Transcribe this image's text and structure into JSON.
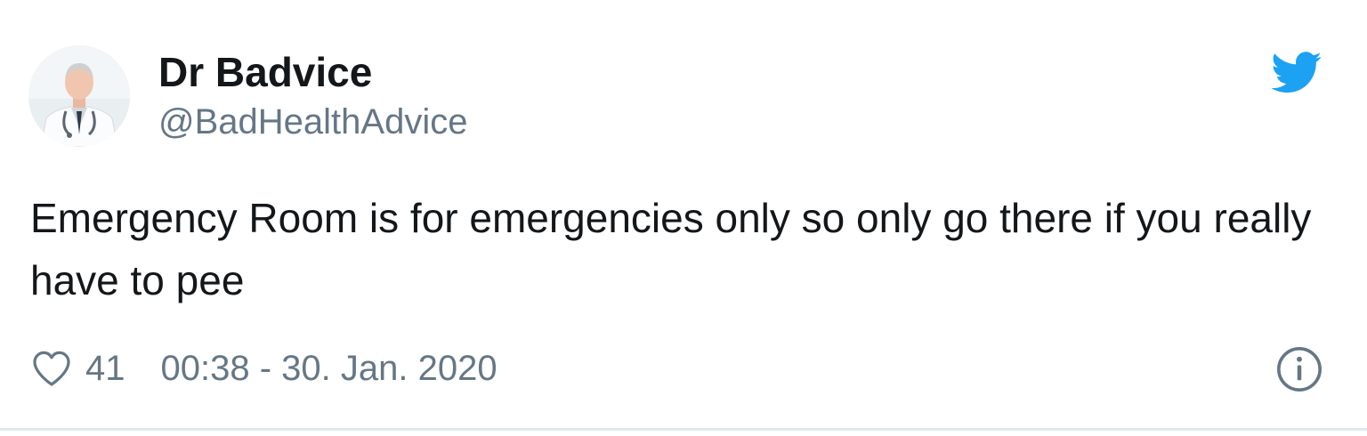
{
  "tweet": {
    "author": {
      "display_name": "Dr Badvice",
      "handle": "@BadHealthAdvice",
      "avatar_icon": "doctor-avatar"
    },
    "text": "Emergency Room is for emergencies only so only go there if you really have to pee",
    "likes": "41",
    "timestamp": "00:38 - 30. Jan. 2020"
  },
  "icons": {
    "brand": "twitter-bird-icon",
    "like": "heart-icon",
    "info": "info-icon"
  },
  "colors": {
    "twitter_blue": "#1da1f2",
    "text_primary": "#14171a",
    "text_secondary": "#657786",
    "border": "#e1e8ed"
  }
}
